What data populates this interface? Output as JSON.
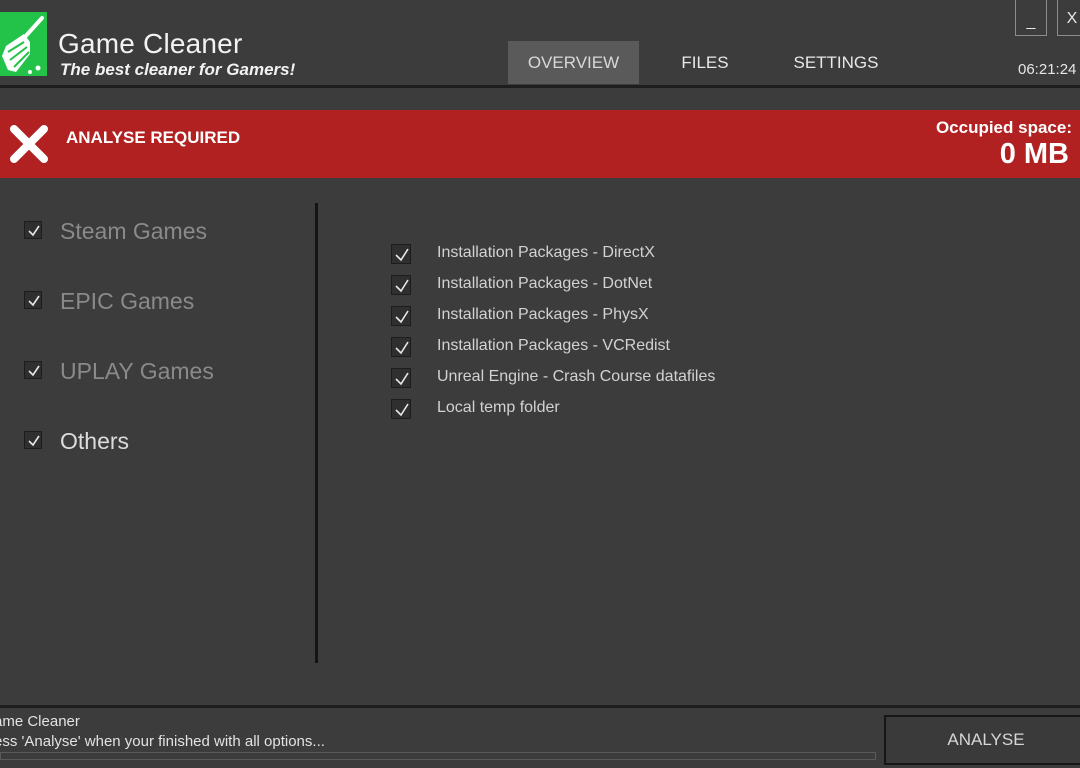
{
  "app": {
    "title": "Game Cleaner",
    "subtitle": "The best cleaner for Gamers!",
    "logo_icon": "broom-icon",
    "accent_color": "#23c34a"
  },
  "tabs": [
    {
      "label": "OVERVIEW",
      "active": true
    },
    {
      "label": "FILES",
      "active": false
    },
    {
      "label": "SETTINGS",
      "active": false
    }
  ],
  "clock": "06:21:24",
  "window_controls": {
    "minimize": "_",
    "close": "X"
  },
  "banner": {
    "status": "ANALYSE REQUIRED",
    "icon": "x-mark-icon",
    "color": "#b12121",
    "occupied_label": "Occupied space:",
    "occupied_value": "0 MB"
  },
  "categories": [
    {
      "label": "Steam Games",
      "checked": true,
      "active": false
    },
    {
      "label": "EPIC Games",
      "checked": true,
      "active": false
    },
    {
      "label": "UPLAY Games",
      "checked": true,
      "active": false
    },
    {
      "label": "Others",
      "checked": true,
      "active": true
    }
  ],
  "options": [
    {
      "label": "Installation Packages - DirectX",
      "checked": true
    },
    {
      "label": "Installation Packages - DotNet",
      "checked": true
    },
    {
      "label": "Installation Packages - PhysX",
      "checked": true
    },
    {
      "label": "Installation Packages - VCRedist",
      "checked": true
    },
    {
      "label": "Unreal Engine - Crash Course datafiles",
      "checked": true
    },
    {
      "label": "Local temp folder",
      "checked": true
    }
  ],
  "footer": {
    "status_title": "ame Cleaner",
    "status_hint": "ess 'Analyse' when your finished with all options...",
    "analyse_label": "ANALYSE",
    "progress": 0
  }
}
